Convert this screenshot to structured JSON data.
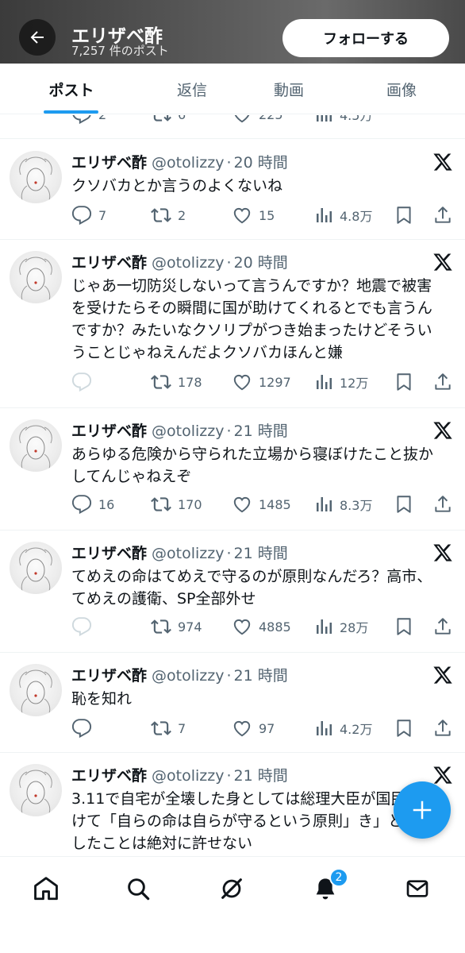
{
  "header": {
    "title": "エリザベ酢",
    "post_count": "7,257 件のポスト",
    "follow_label": "フォローする"
  },
  "tabs": [
    {
      "label": "ポスト",
      "active": true
    },
    {
      "label": "返信",
      "active": false
    },
    {
      "label": "動画",
      "active": false
    },
    {
      "label": "画像",
      "active": false
    }
  ],
  "partial_row": {
    "likes": "225",
    "views": "4.5万"
  },
  "tweets": [
    {
      "name": "エリザベ酢",
      "handle": "@otolizzy",
      "time": "20 時間",
      "text": "クソバカとか言うのよくないね",
      "replies": "7",
      "reposts": "2",
      "likes": "15",
      "views": "4.8万"
    },
    {
      "name": "エリザベ酢",
      "handle": "@otolizzy",
      "time": "20 時間",
      "text": "じゃあ一切防災しないって言うんですか？地震で被害を受けたらその瞬間に国が助けてくれるとでも言うんですか？みたいなクソリプがつき始まったけどそういうことじゃねえんだよクソバカほんと嫌",
      "replies": "",
      "reposts": "178",
      "likes": "1297",
      "views": "12万"
    },
    {
      "name": "エリザベ酢",
      "handle": "@otolizzy",
      "time": "21 時間",
      "text": "あらゆる危険から守られた立場から寝ぼけたこと抜かしてんじゃねえぞ",
      "replies": "16",
      "reposts": "170",
      "likes": "1485",
      "views": "8.3万"
    },
    {
      "name": "エリザベ酢",
      "handle": "@otolizzy",
      "time": "21 時間",
      "text": "てめえの命はてめえで守るのが原則なんだろ？高市、てめえの護衛、SP全部外せ",
      "replies": "",
      "reposts": "974",
      "likes": "4885",
      "views": "28万"
    },
    {
      "name": "エリザベ酢",
      "handle": "@otolizzy",
      "time": "21 時間",
      "text": "恥を知れ",
      "replies": "",
      "reposts": "7",
      "likes": "97",
      "views": "4.2万"
    },
    {
      "name": "エリザベ酢",
      "handle": "@otolizzy",
      "time": "21 時間",
      "text": "3.11で自宅が全壊した身としては総理大臣が国民に向けて「自らの命は自らが守るという原則」き」と発言したことは絶対に許せない"
    }
  ],
  "nav": {
    "notification_badge": "2"
  },
  "colors": {
    "accent": "#1d9bf0",
    "text": "#0f1419",
    "muted": "#536471"
  }
}
